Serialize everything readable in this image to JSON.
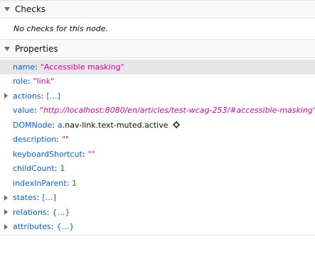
{
  "checks": {
    "title": "Checks",
    "empty_text": "No checks for this node."
  },
  "properties": {
    "title": "Properties",
    "name": {
      "key": "name",
      "value": "\"Accessible masking\""
    },
    "role": {
      "key": "role",
      "value": "\"link\""
    },
    "actions": {
      "key": "actions",
      "value": "[…]"
    },
    "value": {
      "key": "value",
      "value": "\"http://localhost:8080/en/articles/test-wcag-253/#accessible-masking\""
    },
    "domnode": {
      "key": "DOMNode",
      "tag": "a",
      "classes": ".nav-link.text-muted.active"
    },
    "description": {
      "key": "description",
      "value": "\"\""
    },
    "keyboardShortcut": {
      "key": "keyboardShortcut",
      "value": "\"\""
    },
    "childCount": {
      "key": "childCount",
      "value": "1"
    },
    "indexInParent": {
      "key": "indexInParent",
      "value": "1"
    },
    "states": {
      "key": "states",
      "value": "[…]"
    },
    "relations": {
      "key": "relations",
      "value": "{…}"
    },
    "attributes": {
      "key": "attributes",
      "value": "{…}"
    }
  }
}
